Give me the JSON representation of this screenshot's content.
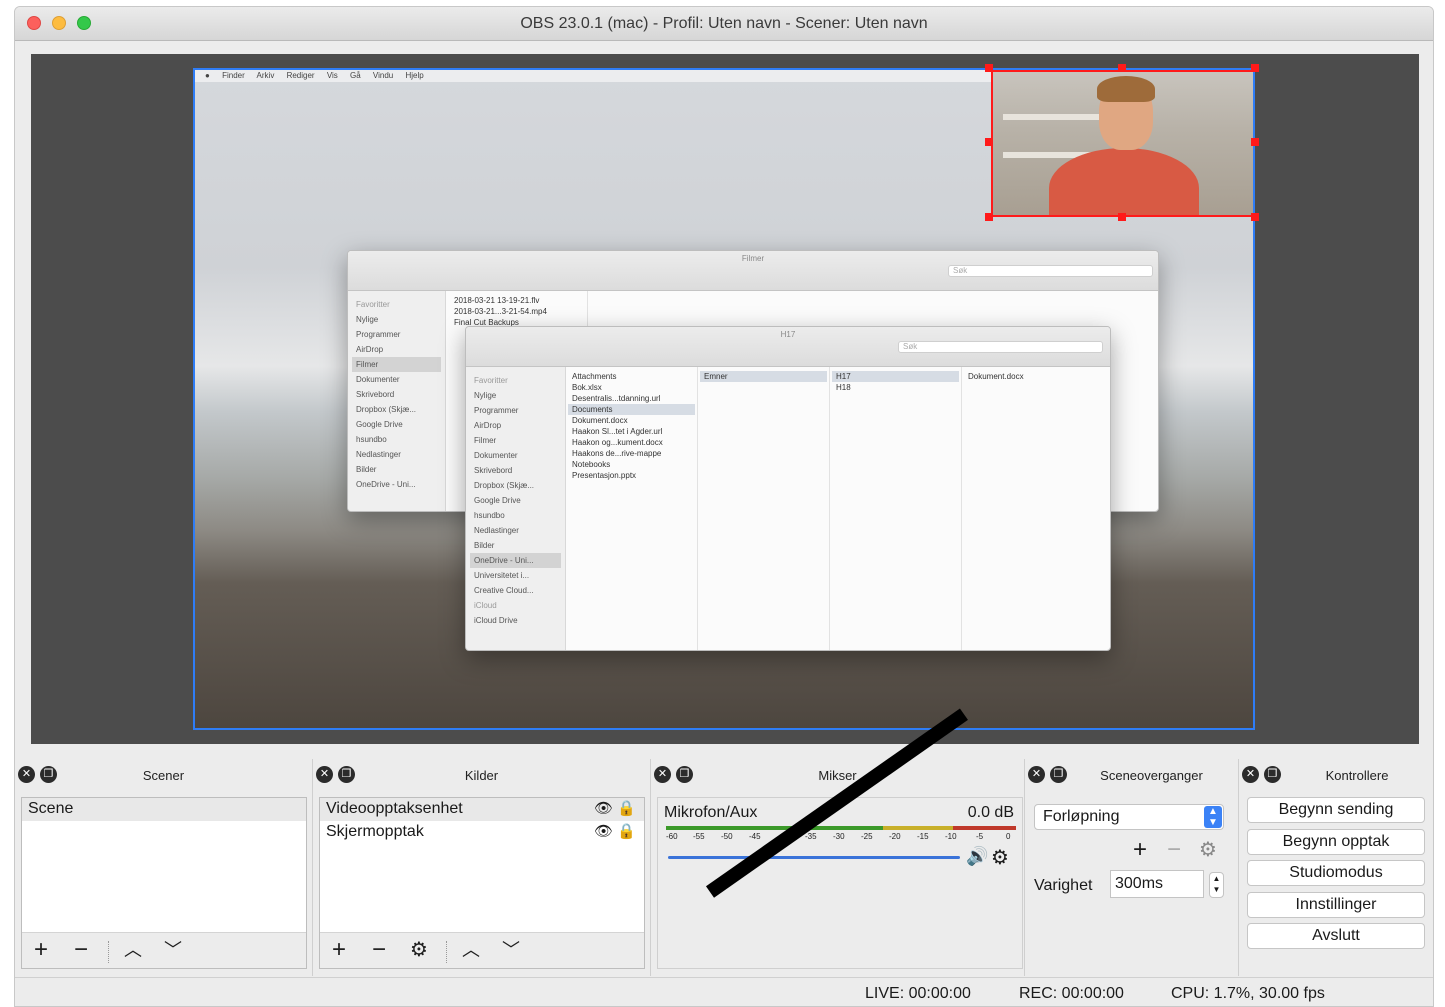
{
  "window": {
    "title": "OBS 23.0.1 (mac) - Profil: Uten navn - Scener: Uten navn"
  },
  "preview": {
    "menubar": [
      "Finder",
      "Arkiv",
      "Rediger",
      "Vis",
      "Gå",
      "Vindu",
      "Hjelp"
    ],
    "finder_back": {
      "title": "Filmer",
      "search_placeholder": "Søk",
      "sidebar_header": "Favoritter",
      "sidebar": [
        "Nylige",
        "Programmer",
        "AirDrop",
        "Filmer",
        "Dokumenter",
        "Skrivebord",
        "Dropbox (Skjæ...",
        "Google Drive",
        "hsundbo",
        "Nedlastinger",
        "Bilder",
        "OneDrive - Uni..."
      ],
      "files": [
        "2018-03-21 13-19-21.flv",
        "2018-03-21...3-21-54.mp4",
        "Final Cut Backups"
      ]
    },
    "finder_front": {
      "title": "H17",
      "search_placeholder": "Søk",
      "sidebar_header": "Favoritter",
      "sidebar": [
        "Nylige",
        "Programmer",
        "AirDrop",
        "Filmer",
        "Dokumenter",
        "Skrivebord",
        "Dropbox (Skjæ...",
        "Google Drive",
        "hsundbo",
        "Nedlastinger",
        "Bilder",
        "OneDrive - Uni...",
        "Universitetet i...",
        "Creative Cloud..."
      ],
      "icloud_header": "iCloud",
      "icloud": [
        "iCloud Drive"
      ],
      "col1": [
        "Attachments",
        "Bok.xlsx",
        "Desentralis...tdanning.url",
        "Documents",
        "Dokument.docx",
        "Haakon Sl...tet i Agder.url",
        "Haakon og...kument.docx",
        "Haakons de...rive-mappe",
        "Notebooks",
        "Presentasjon.pptx"
      ],
      "col2": [
        "Emner"
      ],
      "col3": [
        "H17",
        "H18"
      ],
      "col4": [
        "Dokument.docx"
      ]
    }
  },
  "docks": {
    "scenes": {
      "title": "Scener",
      "items": [
        "Scene"
      ]
    },
    "sources": {
      "title": "Kilder",
      "items": [
        "Videoopptaksenhet",
        "Skjermopptak"
      ]
    },
    "mixer": {
      "title": "Mikser",
      "channel": "Mikrofon/Aux",
      "level": "0.0 dB",
      "ticks": [
        "-60",
        "-55",
        "-50",
        "-45",
        "-40",
        "-35",
        "-30",
        "-25",
        "-20",
        "-15",
        "-10",
        "-5",
        "0"
      ],
      "volume_fraction": 1.0
    },
    "transitions": {
      "title": "Sceneoverganger",
      "selected": "Forløpning",
      "duration_label": "Varighet",
      "duration_value": "300ms"
    },
    "controls": {
      "title": "Kontrollere",
      "buttons": [
        "Begynn sending",
        "Begynn opptak",
        "Studiomodus",
        "Innstillinger",
        "Avslutt"
      ]
    }
  },
  "status": {
    "live": "LIVE: 00:00:00",
    "rec": "REC: 00:00:00",
    "cpu": "CPU: 1.7%, 30.00 fps"
  },
  "colors": {
    "selection_blue": "#2f7df6",
    "webcam_selection_red": "#ff1a1a",
    "meter_green": "#3c9a2a",
    "meter_yellow": "#c8b02a",
    "meter_red": "#c0392b"
  },
  "icons": {
    "dock_close": "close-circle-icon",
    "dock_float": "float-icon",
    "visibility": "eye-icon",
    "lock": "lock-icon",
    "add": "plus-icon",
    "remove": "minus-icon",
    "settings": "gear-icon",
    "move_up": "chevron-up-icon",
    "move_down": "chevron-down-icon",
    "volume": "speaker-icon"
  }
}
